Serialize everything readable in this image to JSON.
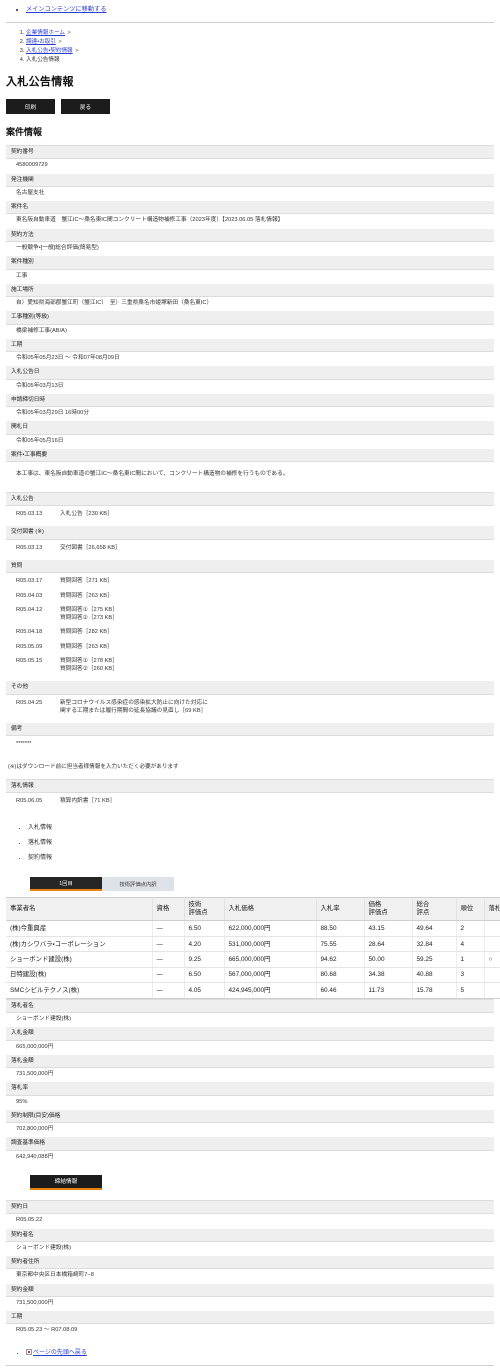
{
  "skip": {
    "label": "メインコンテンツに移動する"
  },
  "breadcrumb": {
    "items": [
      {
        "label": "企業情報ホーム",
        "link": true,
        "sep": ">"
      },
      {
        "label": "調達・お取引",
        "link": true,
        "sep": ">"
      },
      {
        "label": "入札公告・契約情報",
        "link": true,
        "sep": ">"
      },
      {
        "label": "入札公告情報",
        "link": false,
        "sep": ""
      }
    ]
  },
  "page": {
    "title": "入札公告情報"
  },
  "toolbar": {
    "print_label": "印刷",
    "back_label": "戻る"
  },
  "case_section": {
    "title": "案件情報",
    "fields": [
      {
        "label": "契約番号",
        "value": "4580009729"
      },
      {
        "label": "発注機関",
        "value": "名古屋支社"
      },
      {
        "label": "案件名",
        "value": "東名阪自動車道　蟹江IC〜桑名東IC間コンクリート構造物補修工事（2023年度）【2023.06.05 落札情報】"
      },
      {
        "label": "契約方法",
        "value": "一般競争・[一般]総合評価(簡易型)"
      },
      {
        "label": "案件種別",
        "value": "工事"
      },
      {
        "label": "施工場所",
        "value": "自）愛知県海部郡蟹江町（蟹江IC）　至）三重県桑名市姫塚新田（桑名東IC）"
      },
      {
        "label": "工事種別(等級)",
        "value": "橋梁補修工事(AB/A)"
      },
      {
        "label": "工期",
        "value": "令和05年05月23日 〜 令和07年08月09日"
      },
      {
        "label": "入札公告日",
        "value": "令和05年03月13日"
      },
      {
        "label": "申請締切日時",
        "value": "令和05年03月29日 16時00分"
      },
      {
        "label": "開札日",
        "value": "令和05年05月16日"
      },
      {
        "label": "案件・工事概要",
        "value": "本工事は、東名阪自動車道の蟹江IC〜桑名東IC間において、コンクリート構造物の補修を行うものである。"
      }
    ]
  },
  "documents": {
    "groups": [
      {
        "label": "入札公告",
        "rows": [
          {
            "date": "R05.03.13",
            "files": [
              "入札公告［230 KB］"
            ]
          }
        ]
      },
      {
        "label": "交付図書 (※)",
        "rows": [
          {
            "date": "R05.03.13",
            "files": [
              "交付図書［26,658 KB］"
            ]
          }
        ]
      },
      {
        "label": "質問",
        "rows": [
          {
            "date": "R05.03.17",
            "files": [
              "質問回答［271 KB］"
            ]
          },
          {
            "date": "R05.04.03",
            "files": [
              "質問回答［263 KB］"
            ]
          },
          {
            "date": "R05.04.12",
            "files": [
              "質問回答①［275 KB］",
              "質問回答②［273 KB］"
            ]
          },
          {
            "date": "R05.04.18",
            "files": [
              "質問回答［282 KB］"
            ]
          },
          {
            "date": "R05.05.09",
            "files": [
              "質問回答［263 KB］"
            ]
          },
          {
            "date": "R05.05.15",
            "files": [
              "質問回答①［278 KB］",
              "質問回答②［260 KB］"
            ]
          }
        ]
      },
      {
        "label": "その他",
        "rows": [
          {
            "date": "R05.04.25",
            "files": [
              "新型コロナウイルス感染症の感染拡大防止に向けた対応に",
              "関する工期または履行期間の延長協議の見直し［69 KB］"
            ]
          }
        ]
      },
      {
        "label": "備考",
        "rows": [
          {
            "date": "*******",
            "files": [
              ""
            ]
          }
        ]
      }
    ],
    "note": "(※)はダウンロード前に担当者様情報を入力いただく必要があります"
  },
  "award_docs": {
    "label": "落札情報",
    "rows": [
      {
        "date": "R05.06.05",
        "files": [
          "積算内訳書［71 KB］"
        ]
      }
    ]
  },
  "anchor_links": {
    "items": [
      {
        "label": "入札情報"
      },
      {
        "label": "落札情報"
      },
      {
        "label": "契約情報"
      }
    ]
  },
  "tabs": {
    "items": [
      {
        "label": "1回目",
        "active": true
      },
      {
        "label": "技術評価点内訳",
        "active": false
      }
    ]
  },
  "bid_table": {
    "headers": [
      "事業者名",
      "資格",
      "技術\n評価点",
      "入札価格",
      "入札率",
      "価格\n評価点",
      "総合\n評点",
      "順位",
      "落札"
    ],
    "rows": [
      {
        "name": "(株)今重興産",
        "qualification": "—",
        "tech_score": "6.50",
        "bid_price": "622,000,000円",
        "bid_rate": "88.50",
        "price_score": "43.15",
        "total_score": "49.64",
        "rank": "2",
        "award": ""
      },
      {
        "name": "(株)カシワバラ・コーポレーション",
        "qualification": "—",
        "tech_score": "4.20",
        "bid_price": "531,000,000円",
        "bid_rate": "75.55",
        "price_score": "28.64",
        "total_score": "32.84",
        "rank": "4",
        "award": ""
      },
      {
        "name": "ショーボンド建設(株)",
        "qualification": "—",
        "tech_score": "9.25",
        "bid_price": "665,000,000円",
        "bid_rate": "94.62",
        "price_score": "50.00",
        "total_score": "59.25",
        "rank": "1",
        "award": "○"
      },
      {
        "name": "日特建設(株)",
        "qualification": "—",
        "tech_score": "6.50",
        "bid_price": "567,000,000円",
        "bid_rate": "80.68",
        "price_score": "34.38",
        "total_score": "40.88",
        "rank": "3",
        "award": ""
      },
      {
        "name": "SMCシビルテクノス(株)",
        "qualification": "—",
        "tech_score": "4.05",
        "bid_price": "424,945,000円",
        "bid_rate": "60.46",
        "price_score": "11.73",
        "total_score": "15.78",
        "rank": "5",
        "award": ""
      }
    ]
  },
  "award_section": {
    "fields": [
      {
        "label": "落札者名",
        "value": "ショーボンド建設(株)"
      },
      {
        "label": "入札金額",
        "value": "665,000,000円"
      },
      {
        "label": "落札金額",
        "value": "731,500,000円"
      },
      {
        "label": "落札率",
        "value": "95%"
      },
      {
        "label": "契約制限(目安)価格",
        "value": "702,800,000円"
      },
      {
        "label": "調査基準価格",
        "value": "642,940,088円"
      }
    ]
  },
  "contract_button": {
    "label": "締結情報"
  },
  "contract_section": {
    "fields": [
      {
        "label": "契約日",
        "value": "R05.05.22"
      },
      {
        "label": "契約者名",
        "value": "ショーボンド建設(株)"
      },
      {
        "label": "契約者住所",
        "value": "東京都中央区日本橋箱崎町7−8"
      },
      {
        "label": "契約金額",
        "value": "731,500,000円"
      },
      {
        "label": "工期",
        "value": "R05.05.23 〜 R07.08.09"
      }
    ]
  },
  "footer": {
    "back_to_top": "ページの先頭へ戻る"
  }
}
